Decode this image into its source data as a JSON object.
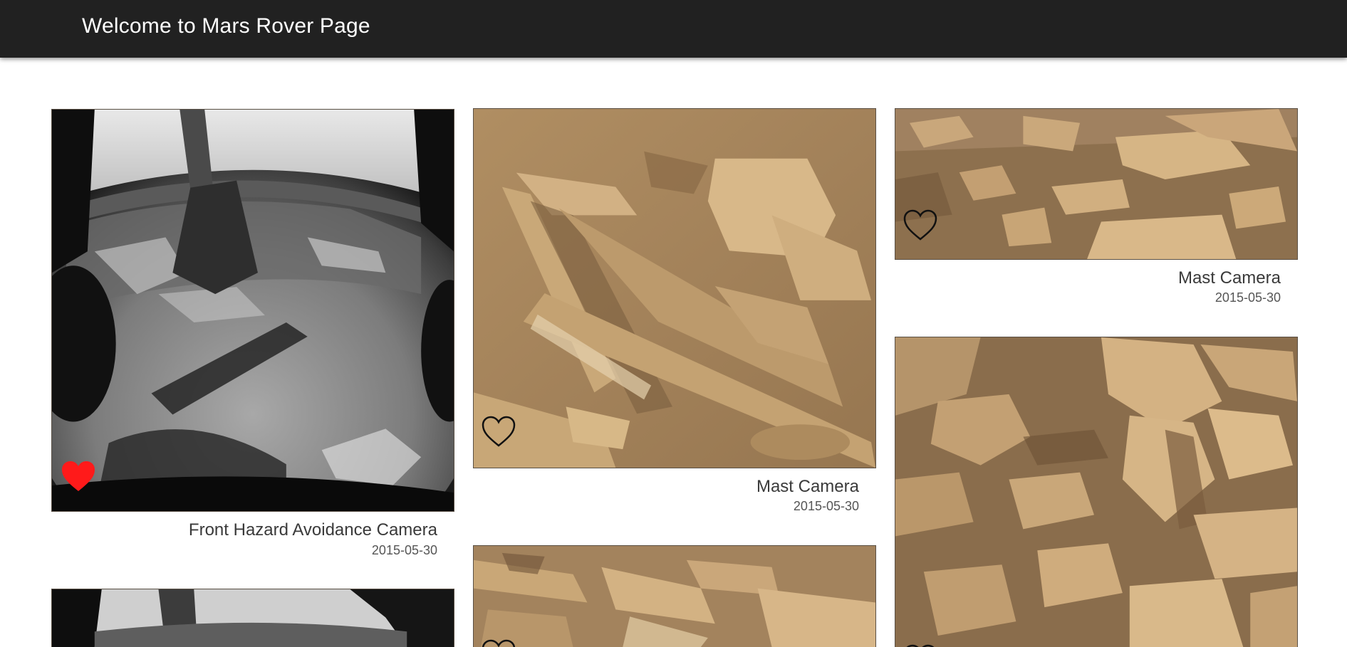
{
  "header": {
    "title": "Welcome to Mars Rover Page"
  },
  "photos": [
    {
      "camera": "Front Hazard Avoidance Camera",
      "date": "2015-05-30",
      "favorited": true,
      "fav_icon": "heart-filled-icon",
      "image_style": "grayscale fisheye hazcam"
    },
    {
      "camera": "Mast Camera",
      "date": "2015-05-30",
      "favorited": false,
      "fav_icon": "heart-outline-icon",
      "image_style": "color rock layers"
    },
    {
      "camera": "Mast Camera",
      "date": "2015-05-30",
      "favorited": false,
      "fav_icon": "heart-outline-icon",
      "image_style": "color rocky ground"
    },
    {
      "camera": "",
      "date": "",
      "favorited": false,
      "fav_icon": "heart-outline-icon",
      "image_style": "grayscale fisheye hazcam"
    },
    {
      "camera": "",
      "date": "",
      "favorited": false,
      "fav_icon": "heart-outline-icon",
      "image_style": "color layered rock"
    },
    {
      "camera": "",
      "date": "",
      "favorited": false,
      "fav_icon": "heart-outline-icon",
      "image_style": "color broken rocks"
    }
  ],
  "colors": {
    "header_bg": "#212121",
    "favorite_active": "#ff1a1a",
    "favorite_inactive": "#111111"
  }
}
